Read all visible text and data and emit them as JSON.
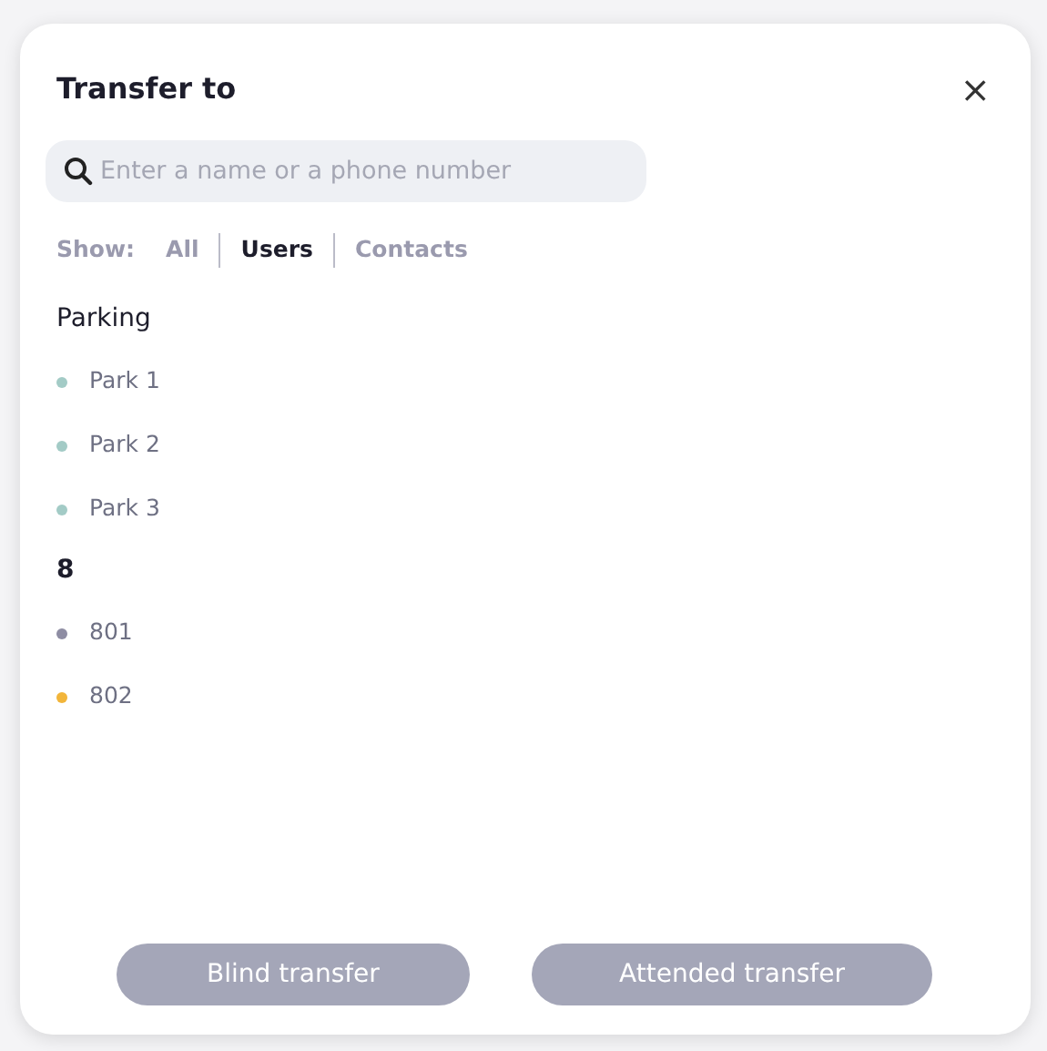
{
  "dialog": {
    "title": "Transfer to",
    "close": "×"
  },
  "search": {
    "placeholder": "Enter a name or a phone number"
  },
  "filter": {
    "label": "Show:",
    "options": [
      {
        "label": "All",
        "selected": false
      },
      {
        "label": "Users",
        "selected": true
      },
      {
        "label": "Contacts",
        "selected": false
      }
    ]
  },
  "groups": [
    {
      "title": "Parking",
      "kind": "plain",
      "items": [
        {
          "name": "Park 1",
          "color": "#a3cbc6"
        },
        {
          "name": "Park 2",
          "color": "#a3cbc6"
        },
        {
          "name": "Park 3",
          "color": "#a3cbc6"
        }
      ]
    },
    {
      "title": "8",
      "kind": "bold",
      "items": [
        {
          "name": "801",
          "color": "#8e8da3"
        },
        {
          "name": "802",
          "color": "#f2b53a"
        }
      ]
    }
  ],
  "buttons": [
    {
      "label": "Blind transfer",
      "disabled": true
    },
    {
      "label": "Attended transfer",
      "disabled": true
    }
  ]
}
